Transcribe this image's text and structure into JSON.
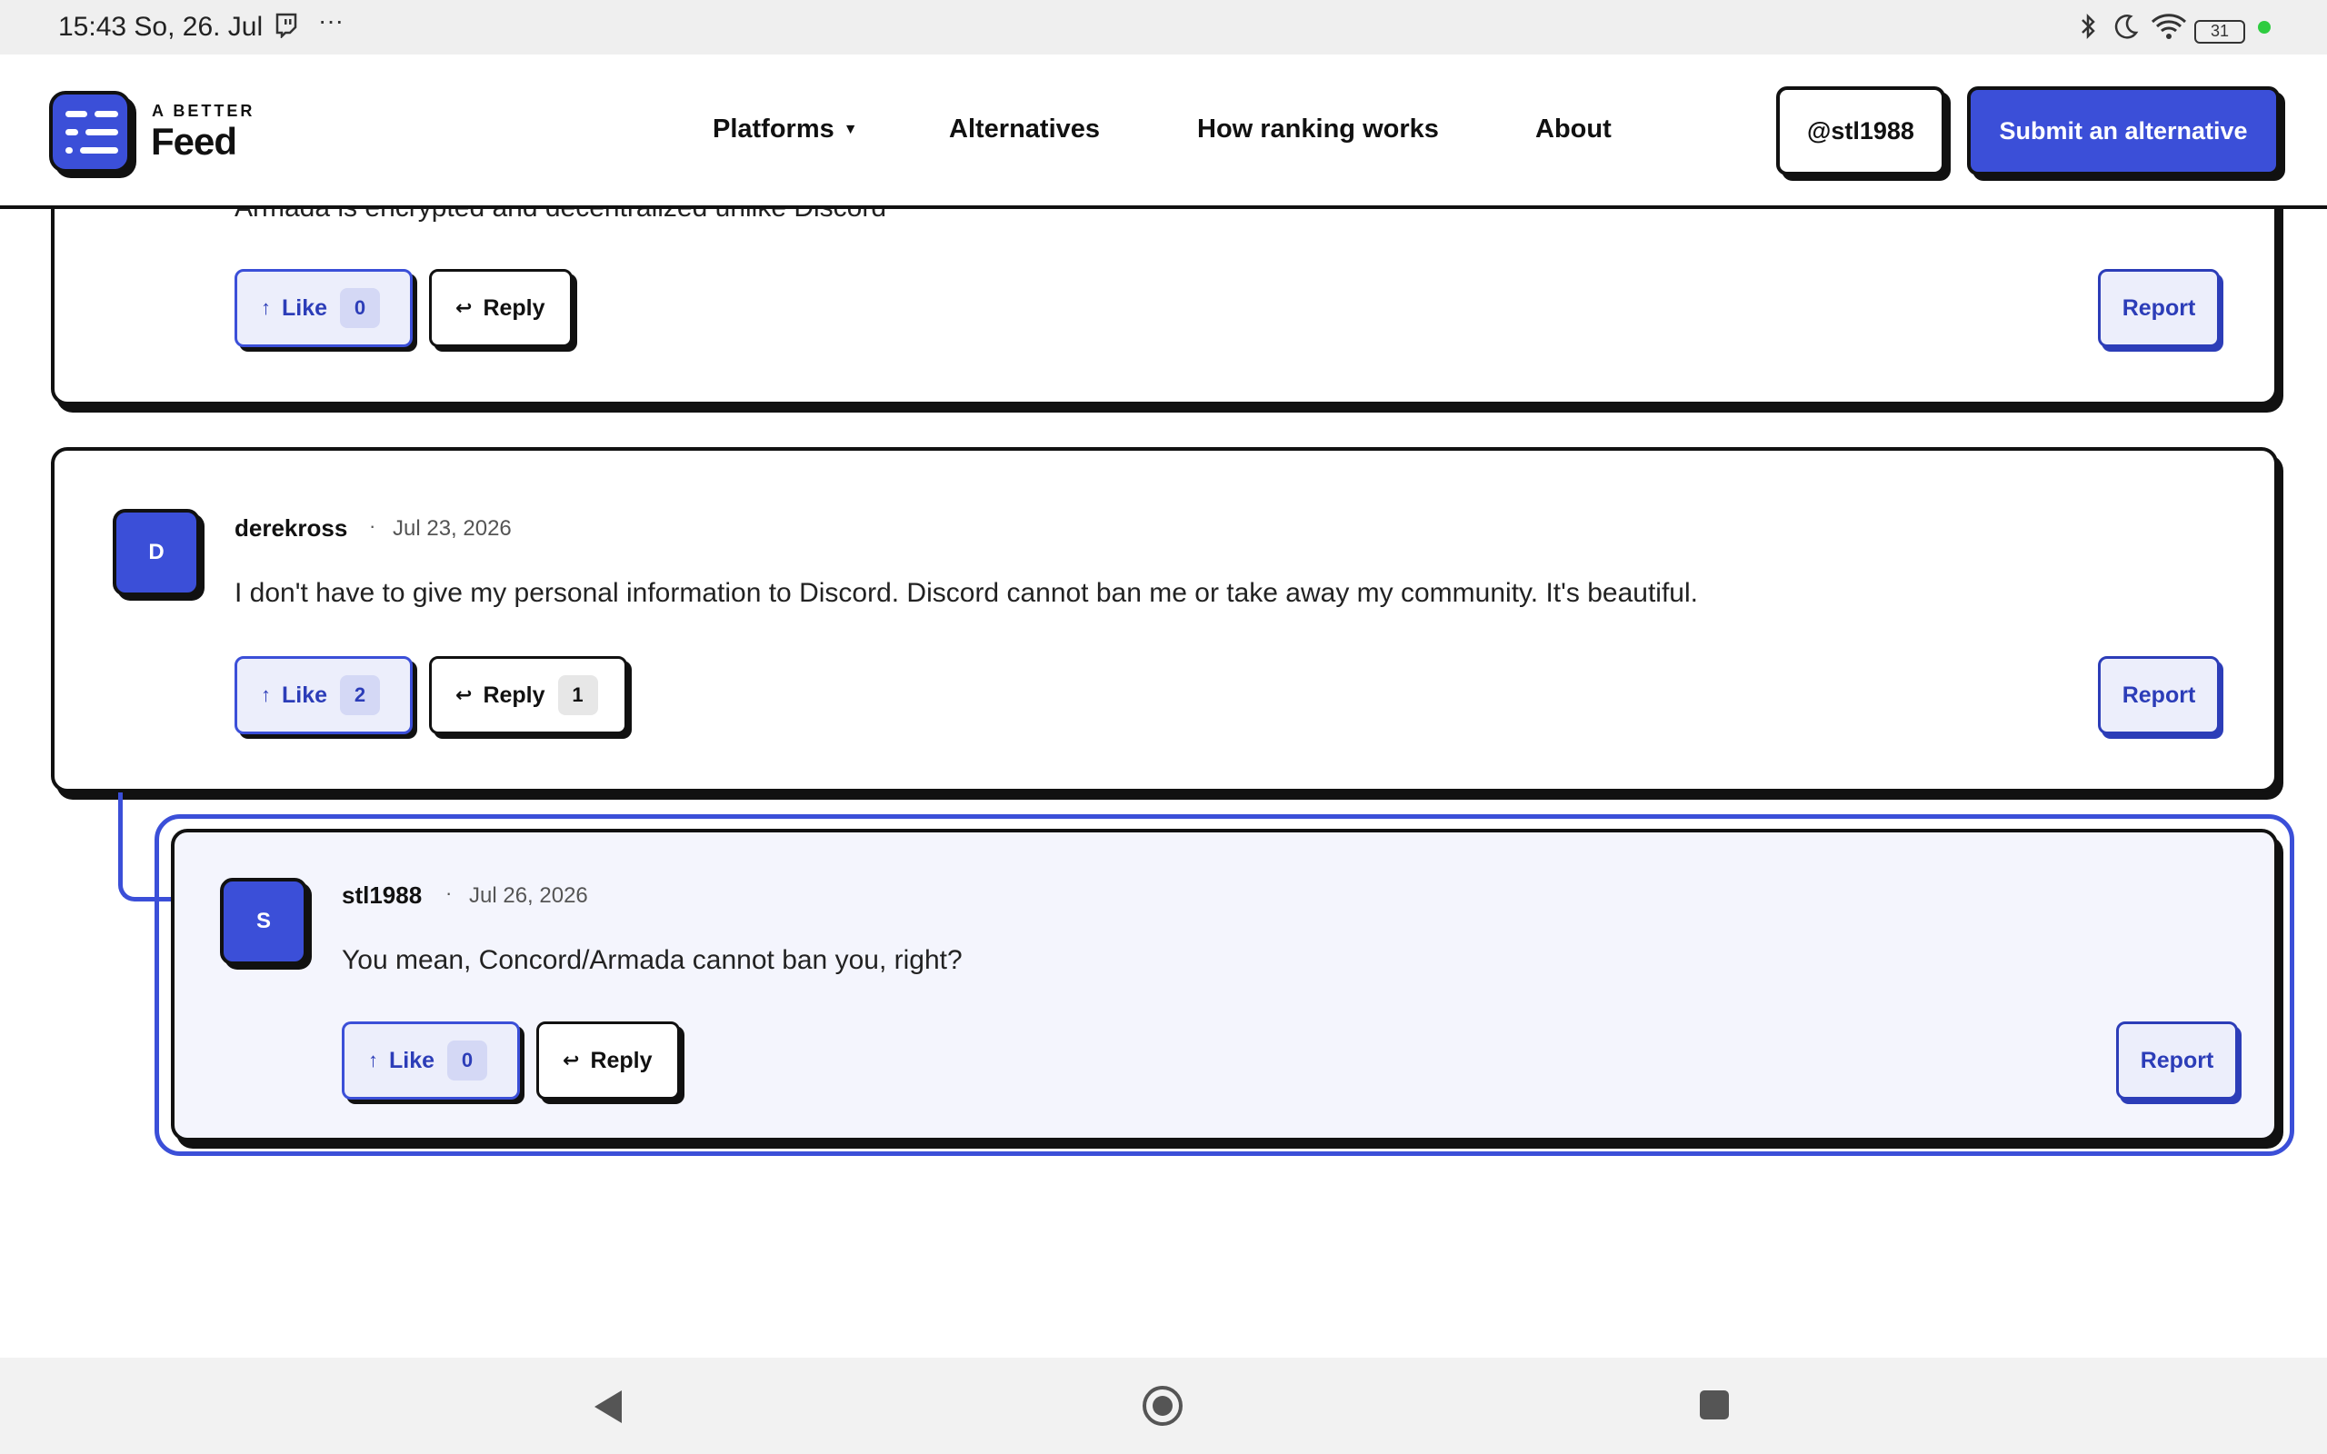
{
  "status_bar": {
    "time": "15:43 So, 26. Jul",
    "more": "···",
    "battery": "31"
  },
  "header": {
    "brand_top": "A BETTER",
    "brand_main": "Feed",
    "nav": {
      "platforms": "Platforms",
      "alternatives": "Alternatives",
      "how_ranking": "How ranking works",
      "about": "About"
    },
    "user_button": "@stl1988",
    "submit_button": "Submit an alternative"
  },
  "comments": [
    {
      "text": "Armada is encrypted and decentralized unlike Discord",
      "like_label": "Like",
      "like_count": "0",
      "reply_label": "Reply",
      "report_label": "Report"
    },
    {
      "avatar": "D",
      "author": "derekross",
      "date": "Jul 23, 2026",
      "text": "I don't have to give my personal information to Discord. Discord cannot ban me or take away my community. It's beautiful.",
      "like_label": "Like",
      "like_count": "2",
      "reply_label": "Reply",
      "reply_count": "1",
      "report_label": "Report"
    },
    {
      "avatar": "S",
      "author": "stl1988",
      "date": "Jul 26, 2026",
      "text": "You mean, Concord/Armada cannot ban you, right?",
      "like_label": "Like",
      "like_count": "0",
      "reply_label": "Reply",
      "report_label": "Report"
    }
  ],
  "colors": {
    "accent": "#3b4fd8",
    "border": "#111111",
    "highlight_bg": "#f4f5fd"
  }
}
